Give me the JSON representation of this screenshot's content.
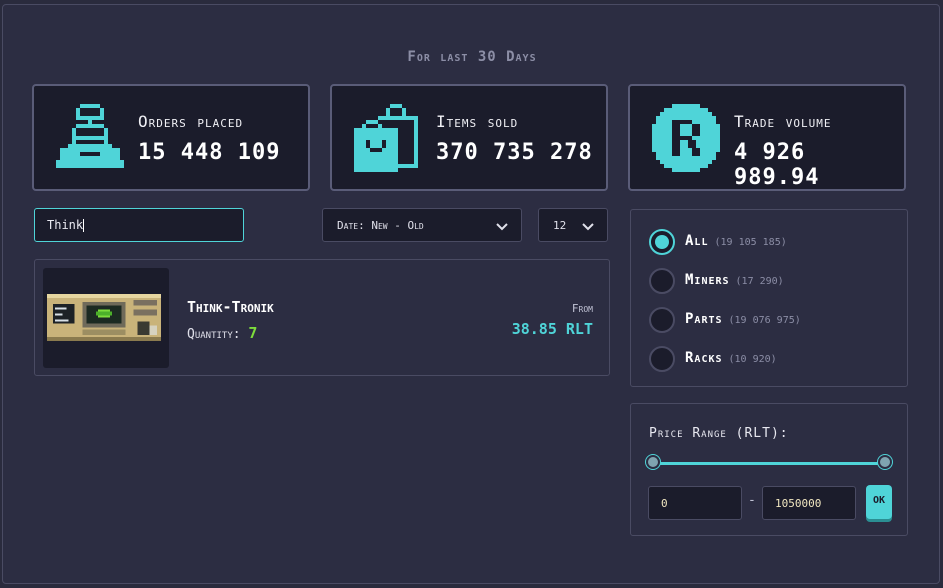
{
  "header": {
    "period": "For last 30 Days"
  },
  "stats": [
    {
      "label": "Orders placed",
      "value": "15 448 109",
      "icon": "cash-register-icon"
    },
    {
      "label": "Items sold",
      "value": "370 735 278",
      "icon": "shopping-bags-icon"
    },
    {
      "label": "Trade volume",
      "value": "4 926 989.94",
      "icon": "rlt-coin-icon"
    }
  ],
  "search": {
    "value": "Think"
  },
  "sort": {
    "selected": "Date: New - Old"
  },
  "per_page": {
    "selected": "12"
  },
  "results": [
    {
      "name": "Think-Tronik",
      "quantity_label": "Quantity:",
      "quantity": "7",
      "from_label": "From",
      "price": "38.85 RLT"
    }
  ],
  "categories": [
    {
      "label": "All",
      "count": "(19 105 185)",
      "selected": true
    },
    {
      "label": "Miners",
      "count": "(17 290)",
      "selected": false
    },
    {
      "label": "Parts",
      "count": "(19 076 975)",
      "selected": false
    },
    {
      "label": "Racks",
      "count": "(10 920)",
      "selected": false
    }
  ],
  "price_range": {
    "title": "Price Range (RLT):",
    "min": "0",
    "max": "1050000",
    "separator": "-",
    "ok_label": "OK"
  },
  "colors": {
    "accent": "#4fd4d8",
    "background": "#2c2d42",
    "card": "#1b1c2b",
    "quantity": "#7ddc3c"
  }
}
